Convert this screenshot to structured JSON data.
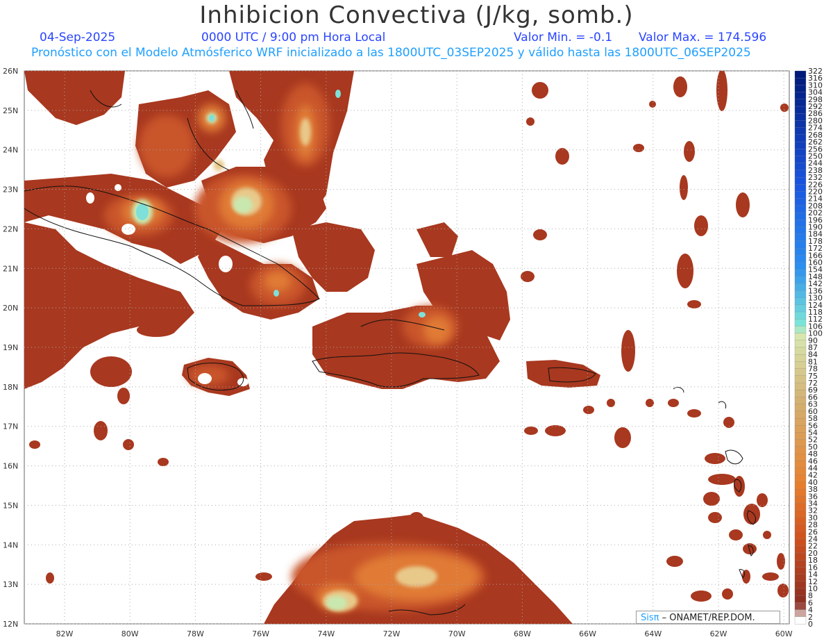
{
  "title": "Inhibicion Convectiva (J/kg, somb.)",
  "date": "04-Sep-2025",
  "time": "0000 UTC / 9:00 pm Hora Local",
  "valmin": "Valor Min. = -0.1",
  "valmax": "Valor Max. = 174.596",
  "subtitle": "Pronóstico con el Modelo Atmósferico WRF inicializado a las 1800UTC_03SEP2025 y válido hasta las  1800UTC_06SEP2025",
  "credit": {
    "sis": "Sisπ",
    "rest": " – ONAMET/REP.DOM."
  },
  "lat_labels": [
    "26N",
    "25N",
    "24N",
    "23N",
    "22N",
    "21N",
    "20N",
    "19N",
    "18N",
    "17N",
    "16N",
    "15N",
    "14N",
    "13N",
    "12N"
  ],
  "lon_labels": [
    "82W",
    "80W",
    "78W",
    "76W",
    "74W",
    "72W",
    "70W",
    "68W",
    "66W",
    "64W",
    "62W",
    "60W"
  ],
  "colorbar_labels": [
    "322",
    "316",
    "310",
    "304",
    "298",
    "292",
    "286",
    "280",
    "274",
    "268",
    "262",
    "256",
    "250",
    "244",
    "238",
    "232",
    "226",
    "220",
    "214",
    "208",
    "202",
    "196",
    "190",
    "184",
    "178",
    "172",
    "166",
    "160",
    "154",
    "148",
    "142",
    "136",
    "130",
    "124",
    "118",
    "112",
    "106",
    "100",
    "90",
    "87",
    "84",
    "81",
    "78",
    "75",
    "72",
    "69",
    "66",
    "63",
    "60",
    "58",
    "56",
    "54",
    "52",
    "50",
    "48",
    "46",
    "44",
    "42",
    "40",
    "38",
    "36",
    "34",
    "32",
    "30",
    "28",
    "26",
    "24",
    "22",
    "20",
    "18",
    "16",
    "14",
    "12",
    "10",
    "8",
    "6",
    "4",
    "2",
    "0"
  ],
  "colors": {
    "base": "#a8381f",
    "warm": "#c9542a",
    "hot": "#e07a34",
    "pale": "#e8c98a",
    "green": "#c8e8b0",
    "cyan": "#7ee0d8",
    "coast": "#111111"
  }
}
